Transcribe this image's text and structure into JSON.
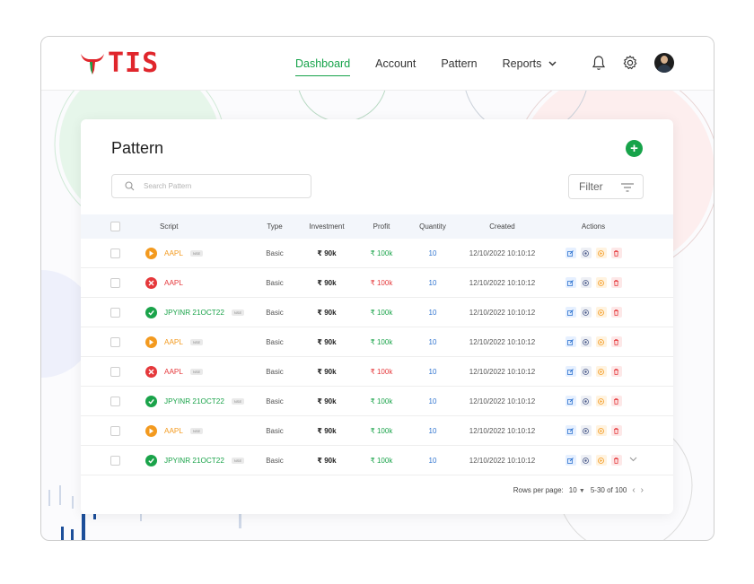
{
  "brand": {
    "logo_text": "TIS",
    "color": "#e0262c"
  },
  "nav": {
    "items": [
      {
        "label": "Dashboard",
        "active": true
      },
      {
        "label": "Account",
        "active": false
      },
      {
        "label": "Pattern",
        "active": false
      },
      {
        "label": "Reports",
        "active": false
      }
    ],
    "icons": [
      "bell-icon",
      "gear-icon",
      "avatar"
    ]
  },
  "page": {
    "title": "Pattern",
    "search_placeholder": "Search Pattern",
    "filter_label": "Filter"
  },
  "table": {
    "headers": [
      "Script",
      "Type",
      "Investment",
      "Profit",
      "Quantity",
      "Created",
      "Actions"
    ],
    "rows": [
      {
        "status": "pending",
        "status_color": "orange",
        "script": "AAPL",
        "tag": "NSE",
        "type": "Basic",
        "investment": "₹ 90k",
        "profit": "₹ 100k",
        "profit_color": "green",
        "quantity": "10",
        "created": "12/10/2022 10:10:12"
      },
      {
        "status": "failed",
        "status_color": "red",
        "script": "AAPL",
        "tag": "",
        "type": "Basic",
        "investment": "₹ 90k",
        "profit": "₹ 100k",
        "profit_color": "red",
        "quantity": "10",
        "created": "12/10/2022 10:10:12"
      },
      {
        "status": "success",
        "status_color": "green",
        "script": "JPYINR 21OCT22",
        "tag": "NSE",
        "type": "Basic",
        "investment": "₹ 90k",
        "profit": "₹ 100k",
        "profit_color": "green",
        "quantity": "10",
        "created": "12/10/2022 10:10:12"
      },
      {
        "status": "pending",
        "status_color": "orange",
        "script": "AAPL",
        "tag": "NSE",
        "type": "Basic",
        "investment": "₹ 90k",
        "profit": "₹ 100k",
        "profit_color": "green",
        "quantity": "10",
        "created": "12/10/2022 10:10:12"
      },
      {
        "status": "failed",
        "status_color": "red",
        "script": "AAPL",
        "tag": "NSE",
        "type": "Basic",
        "investment": "₹ 90k",
        "profit": "₹ 100k",
        "profit_color": "red",
        "quantity": "10",
        "created": "12/10/2022 10:10:12"
      },
      {
        "status": "success",
        "status_color": "green",
        "script": "JPYINR 21OCT22",
        "tag": "NSE",
        "type": "Basic",
        "investment": "₹ 90k",
        "profit": "₹ 100k",
        "profit_color": "green",
        "quantity": "10",
        "created": "12/10/2022 10:10:12"
      },
      {
        "status": "pending",
        "status_color": "orange",
        "script": "AAPL",
        "tag": "NSE",
        "type": "Basic",
        "investment": "₹ 90k",
        "profit": "₹ 100k",
        "profit_color": "green",
        "quantity": "10",
        "created": "12/10/2022 10:10:12"
      },
      {
        "status": "success",
        "status_color": "green",
        "script": "JPYINR 21OCT22",
        "tag": "NSE",
        "type": "Basic",
        "investment": "₹ 90k",
        "profit": "₹ 100k",
        "profit_color": "green",
        "quantity": "10",
        "created": "12/10/2022 10:10:12",
        "expandable": true
      }
    ],
    "action_icons": [
      "edit-icon",
      "view-icon",
      "play-icon",
      "delete-icon"
    ]
  },
  "pagination": {
    "rows_per_page_label": "Rows per page:",
    "rows_per_page": "10",
    "range": "5-30 of 100"
  },
  "colors": {
    "accent": "#16a34a",
    "orange": "#f39a1f",
    "red": "#e5383b",
    "blue": "#2f74d0"
  }
}
